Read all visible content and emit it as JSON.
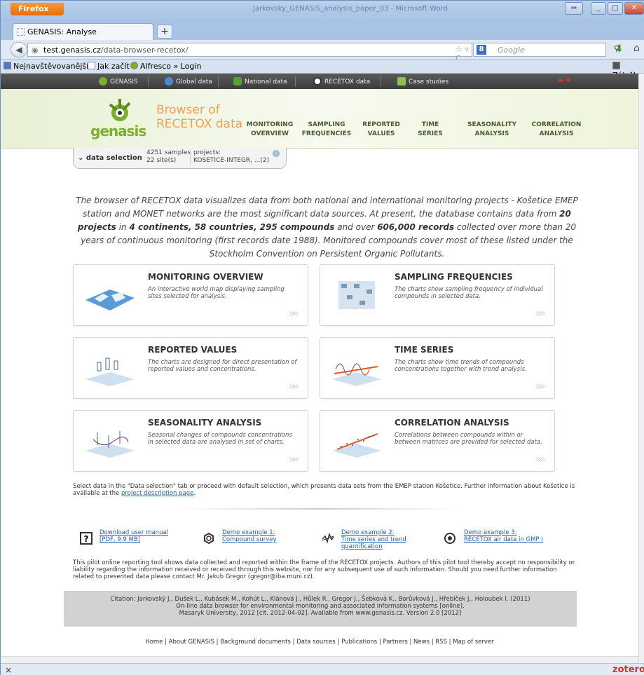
{
  "browser": {
    "app_button": "Firefox",
    "window_title": "Jarkovsky_GENASIS_analysis_paper_03 - Microsoft Word",
    "tab_title": "GENASIS: Analyse",
    "new_tab": "+",
    "url_domain": "test.genasis.cz",
    "url_path": "/data-browser-recetox/",
    "search_placeholder": "Google",
    "bookmarks": [
      "Nejnavštěvovanější",
      "Jak začít",
      "Alfresco » Login"
    ],
    "bookmarks_right": "Záložky",
    "status_close": "×",
    "zotero": "zotero"
  },
  "site": {
    "topnav": [
      "GENASIS",
      "Global data",
      "National data",
      "RECETOX data",
      "Case studies"
    ],
    "logo_text": "genasis",
    "title_line1": "Browser of",
    "title_line2": "RECETOX data",
    "menu": [
      {
        "l1": "MONITORING",
        "l2": "OVERVIEW"
      },
      {
        "l1": "SAMPLING",
        "l2": "FREQUENCIES"
      },
      {
        "l1": "REPORTED",
        "l2": "VALUES"
      },
      {
        "l1": "TIME",
        "l2": "SERIES"
      },
      {
        "l1": "SEASONALITY",
        "l2": "ANALYSIS"
      },
      {
        "l1": "CORRELATION",
        "l2": "ANALYSIS"
      }
    ],
    "data_selection": {
      "label": "data selection",
      "samples": "4251 samples",
      "sites": "22 site(s)",
      "projects_label": "projects:",
      "projects_value": "KOSETICE-INTEGR, ...(2)"
    },
    "intro": {
      "p1": "The browser of RECETOX data visualizes data from both national and international monitoring projects - Košetice EMEP station and MONET networks are the most significant data sources. At present, the database contains data from ",
      "b1": "20 projects",
      "p2": " in ",
      "b2": "4 continents, 58 countries, 295 compounds",
      "p3": " and over ",
      "b3": "606,000 records",
      "p4": " collected over more than 20 years of continuous monitoring (first records date 1988). Monitored compounds cover most of these listed under the Stockholm Convention on Persistent Organic Pollutants."
    },
    "cards": [
      {
        "title": "MONITORING OVERVIEW",
        "desc": "An interactive world map displaying sampling sites selected for analysis."
      },
      {
        "title": "SAMPLING FREQUENCIES",
        "desc": "The charts show sampling frequency of individual compounds in selected data."
      },
      {
        "title": "REPORTED VALUES",
        "desc": "The charts are designed for direct presentation of reported values and concentrations."
      },
      {
        "title": "TIME SERIES",
        "desc": "The charts show time trends of compounds concentrations together with trend analysis."
      },
      {
        "title": "SEASONALITY ANALYSIS",
        "desc": "Seasonal changes of compounds concentrations in selected data are analysed in set of charts."
      },
      {
        "title": "CORRELATION ANALYSIS",
        "desc": "Correlations between compounds within or between matrices are provided for selected data."
      }
    ],
    "card_arrow": "»»",
    "note_text": "Select data in the \"Data selection\" tab or proceed with default selection, which presents data sets from the EMEP station Košetice. Further information about Košetice is available at the ",
    "note_link": "project description page",
    "note_end": ".",
    "downloads": [
      {
        "l1": "Download user manual",
        "l2": "[PDF, 9.9 MB]",
        "l3": ""
      },
      {
        "l1": "Demo example 1:",
        "l2": "Compound survey",
        "l3": ""
      },
      {
        "l1": "Demo example 2:",
        "l2": "Time series and trend",
        "l3": "quantification"
      },
      {
        "l1": "Demo example 3:",
        "l2": "RECETOX air data in GMP I",
        "l3": ""
      }
    ],
    "disclaimer": "This pilot online reporting tool shows data collected and reported within the frame of the RECETOX projects. Authors of this pilot tool thereby accept no responsibility or liability regarding the information received or received through this website, nor for any subsequent use of such information. Should you need further information related to presented data please contact Mr. Jakub Gregor (gregor@iba.muni.cz).",
    "citation": [
      "Citation: Jarkovský J., Dušek L., Kubásek M., Kohút L., Klánová J., Hůlek R., Gregor J., Šebková K., Borůvková J., Hřebíček J., Holoubek I. (2011)",
      "On-line data browser for environmental monitoring and associated information systems [online].",
      "Masaryk University, 2012 [cit. 2012-04-02]. Available from www.genasis.cz. Version 2.0 [2012]"
    ],
    "footer": "Home | About GENASIS | Background documents | Data sources | Publications | Partners | News | RSS | Map of server"
  }
}
